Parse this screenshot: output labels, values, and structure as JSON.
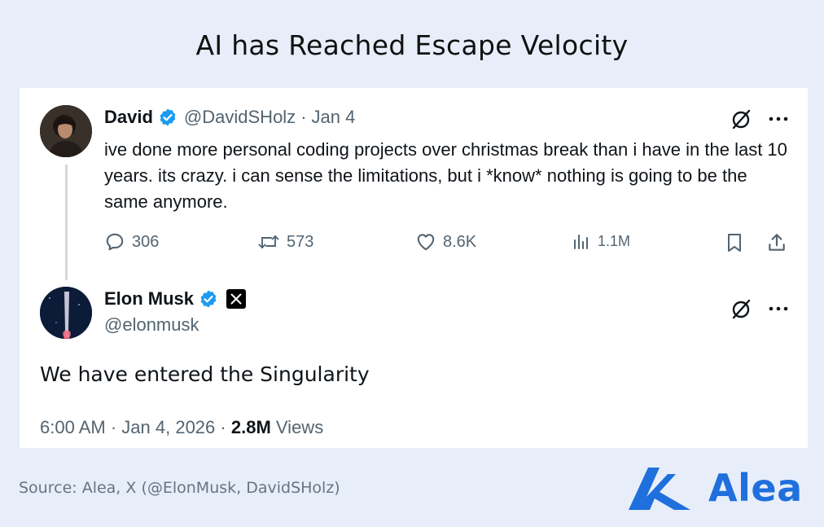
{
  "header": {
    "title": "AI has Reached Escape Velocity"
  },
  "tweet": {
    "author_name": "David",
    "author_handle": "@DavidSHolz",
    "separator": "·",
    "date": "Jan 4",
    "text": "ive done more personal coding projects over christmas break than i have in the last 10 years. its crazy. i can sense the limitations, but i *know* nothing is going to be the same anymore.",
    "stats": {
      "replies": "306",
      "retweets": "573",
      "likes": "8.6K",
      "views": "1.1M"
    }
  },
  "reply": {
    "author_name": "Elon Musk",
    "author_handle": "@elonmusk",
    "text": "We have entered the Singularity",
    "time": "6:00 AM",
    "date": "Jan 4, 2026",
    "separator": "·",
    "views_count": "2.8M",
    "views_label": "Views"
  },
  "footer": {
    "source": "Source: Alea, X (@ElonMusk, DavidSHolz)",
    "brand": "Alea"
  },
  "colors": {
    "background": "#e7eefa",
    "verified_blue": "#1d9bf0",
    "brand_blue": "#1f6fdd",
    "muted_text": "#536471"
  },
  "icons": [
    "verified-icon",
    "grok-icon",
    "more-icon",
    "reply-icon",
    "retweet-icon",
    "like-icon",
    "views-icon",
    "bookmark-icon",
    "share-icon",
    "x-affiliate-icon",
    "alea-logo"
  ]
}
